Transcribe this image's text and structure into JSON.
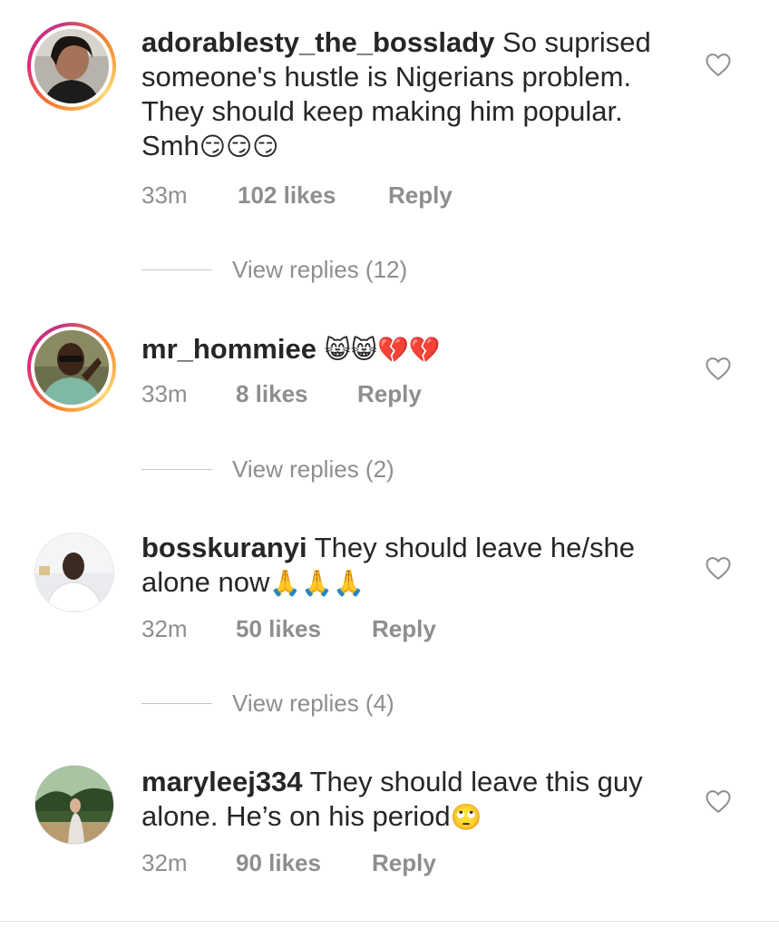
{
  "comments": [
    {
      "username": "adorablesty_the_bosslady",
      "text": "So suprised someone's hustle is Nigerians problem. They should keep making him popular. Smh",
      "emoji": "😏😏😏",
      "time": "33m",
      "likes": "102 likes",
      "reply": "Reply",
      "view_replies": "View replies (12)"
    },
    {
      "username": "mr_hommiee",
      "text": "",
      "emoji": "😸😸💔💔",
      "time": "33m",
      "likes": "8 likes",
      "reply": "Reply",
      "view_replies": "View replies (2)"
    },
    {
      "username": "bosskuranyi",
      "text": "They should leave he/she alone now",
      "emoji": "🙏🙏🙏",
      "time": "32m",
      "likes": "50 likes",
      "reply": "Reply",
      "view_replies": "View replies (4)"
    },
    {
      "username": "maryleej334",
      "text": "They should leave this guy alone. He’s on his period",
      "emoji": "🙄",
      "time": "32m",
      "likes": "90 likes",
      "reply": "Reply"
    }
  ],
  "icons": {
    "like": "heart-outline-icon"
  },
  "colors": {
    "text": "#262626",
    "muted": "#8e8e8e",
    "ring_start": "#f58529",
    "ring_end": "#dd2a7b"
  }
}
